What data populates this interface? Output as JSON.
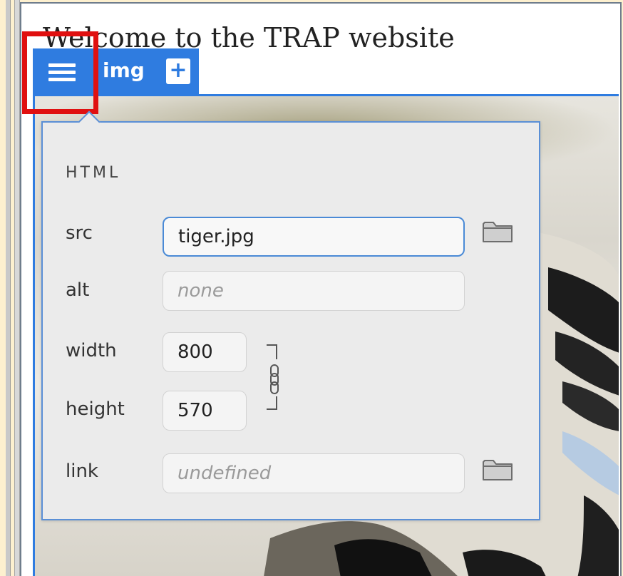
{
  "page": {
    "heading": "Welcome to the TRAP website"
  },
  "toolbar": {
    "element_tag": "img",
    "add_label": "+",
    "menu_icon": "hamburger-menu-icon"
  },
  "panel": {
    "section_title": "HTML",
    "fields": {
      "src": {
        "label": "src",
        "value": "tiger.jpg",
        "browse_icon": "folder-icon"
      },
      "alt": {
        "label": "alt",
        "placeholder": "none"
      },
      "width": {
        "label": "width",
        "value": "800"
      },
      "height": {
        "label": "height",
        "value": "570"
      },
      "link": {
        "label": "link",
        "placeholder": "undefined",
        "browse_icon": "folder-icon"
      }
    },
    "aspect_lock_icon": "chain-link-icon"
  },
  "colors": {
    "accent": "#2f7ce0",
    "highlight": "#e01010",
    "background": "#fdf0cf",
    "panel_bg": "#ebebeb"
  }
}
